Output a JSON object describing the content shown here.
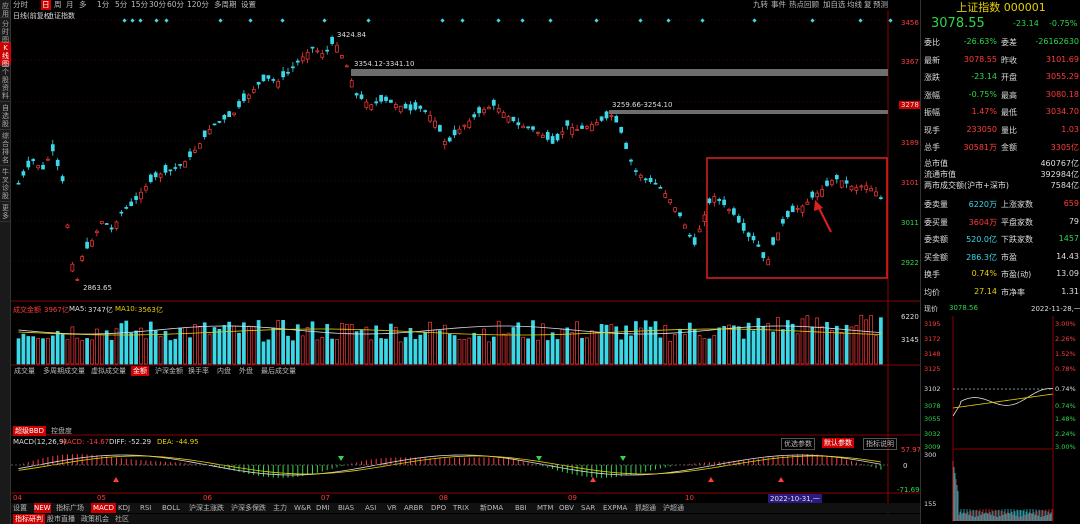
{
  "leftbar": {
    "tabs": [
      "应用",
      "分时图",
      "K线图",
      "个股资料",
      "自选股",
      "综合排名",
      "牛叉诊股",
      "更多"
    ]
  },
  "toolbar": {
    "items": [
      "分时",
      "日",
      "周",
      "月",
      "多",
      "1分",
      "5分",
      "15分",
      "30分",
      "60分",
      "120分",
      "多周期",
      "设置"
    ],
    "right": [
      "九转",
      "事件",
      "热点回顾",
      "加自选",
      "均线",
      "复",
      "预测"
    ]
  },
  "chart": {
    "title": "日线(前复权)",
    "name": "上证指数",
    "price_axis": [
      "3456",
      "3367",
      "3278",
      "3189",
      "3101",
      "3011",
      "2922"
    ],
    "annotations": {
      "high": "3424.84",
      "gap1": "3354.12-3341.10",
      "gap2": "3259.66-3254.10",
      "low": "2863.65"
    },
    "vol_label": "成交金额",
    "vol_value": "3967亿",
    "ma5_label": "MA5:",
    "ma5": "3747亿",
    "ma10_label": "MA10:",
    "ma10": "3563亿",
    "vol_axis": [
      "6220",
      "3145"
    ],
    "subtabs": [
      "成交量",
      "多周期成交量",
      "虚拟成交量",
      "金额",
      "沪深金额",
      "换手率",
      "内盘",
      "外盘",
      "最后成交量"
    ],
    "bbd_tabs": [
      "超级BBD",
      "控盘度"
    ],
    "macd_label": "MACD(12,26,9)",
    "macd_v": "MACD: -14.67",
    "diff_v": "DIFF: -52.29",
    "dea_v": "DEA: -44.95",
    "macd_axis": [
      "57.97",
      "0",
      "-71.69"
    ],
    "macd_buttons": [
      "优选参数",
      "默认参数",
      "指标说明"
    ],
    "months": [
      "04",
      "05",
      "06",
      "07",
      "08",
      "09",
      "10"
    ],
    "date_tag": "2022-10-31,一",
    "indicators": [
      "设置",
      "NEW",
      "指标广场",
      "MACD",
      "KDJ",
      "RSI",
      "BOLL",
      "沪深主涨跌",
      "沪深多保跌",
      "主力",
      "W&R",
      "DMI",
      "BIAS",
      "ASI",
      "VR",
      "ARBR",
      "DPO",
      "TRIX",
      "新DMA",
      "BBI",
      "MTM",
      "OBV",
      "SAR",
      "EXPMA",
      "抓超通",
      "沪超通"
    ],
    "bottom": [
      "指标研判",
      "股市直播",
      "政策机会",
      "社区"
    ]
  },
  "quote": {
    "title": "上证指数",
    "code": "000001",
    "price": "3078.55",
    "change": "-23.14",
    "pct": "-0.75%",
    "rows": [
      [
        "委比",
        "-26.63%",
        "委差",
        "-26162630"
      ],
      [
        "最新",
        "3078.55",
        "昨收",
        "3101.69"
      ],
      [
        "涨跌",
        "-23.14",
        "开盘",
        "3055.29"
      ],
      [
        "涨幅",
        "-0.75%",
        "最高",
        "3080.18"
      ],
      [
        "振幅",
        "1.47%",
        "最低",
        "3034.70"
      ],
      [
        "现手",
        "233050",
        "量比",
        "1.03"
      ],
      [
        "总手",
        "30581万",
        "金额",
        "3305亿"
      ]
    ],
    "rows2": [
      [
        "总市值",
        "460767亿"
      ],
      [
        "流通市值",
        "392984亿"
      ],
      [
        "两市成交额(沪市+深市)",
        "7584亿"
      ]
    ],
    "rows3": [
      [
        "委卖量",
        "6220万",
        "上涨家数",
        "659"
      ],
      [
        "委买量",
        "3604万",
        "平盘家数",
        "79"
      ],
      [
        "委卖额",
        "520.0亿",
        "下跌家数",
        "1457"
      ],
      [
        "买金额",
        "286.3亿",
        "市盈",
        "14.43"
      ],
      [
        "换手",
        "0.74%",
        "市盈(动)",
        "13.09"
      ],
      [
        "均价",
        "27.14",
        "市净率",
        "1.31"
      ]
    ],
    "now_label": "现价",
    "now_val": "3078.56",
    "now_date": "2022-11-28,一",
    "mini_left": [
      "3195",
      "3172",
      "3148",
      "3125",
      "3102",
      "3078",
      "3055",
      "3032",
      "3009"
    ],
    "mini_right": [
      "3.00%",
      "2.26%",
      "1.52%",
      "0.78%",
      "0.74%",
      "0.74%",
      "1.48%",
      "2.24%",
      "3.00%"
    ],
    "mini_vol": [
      "300",
      "155"
    ]
  }
}
